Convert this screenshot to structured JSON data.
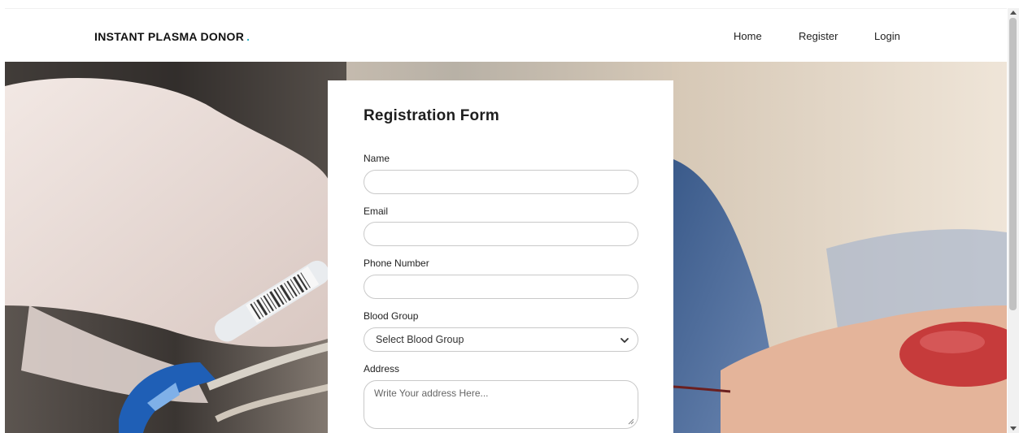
{
  "navbar": {
    "brand": "INSTANT PLASMA DONOR",
    "brand_dot": ".",
    "links": [
      "Home",
      "Register",
      "Login"
    ]
  },
  "form": {
    "title": "Registration Form",
    "name_label": "Name",
    "email_label": "Email",
    "phone_label": "Phone Number",
    "blood_group_label": "Blood Group",
    "blood_group_selected": "Select Blood Group",
    "address_label": "Address",
    "address_placeholder": "Write Your address Here..."
  },
  "colors": {
    "brand_dot": "#2ab0c4",
    "card_bg": "#ffffff",
    "input_border": "#c9c9c9"
  },
  "icons": {
    "select_chevron": "chevron-down-icon"
  }
}
